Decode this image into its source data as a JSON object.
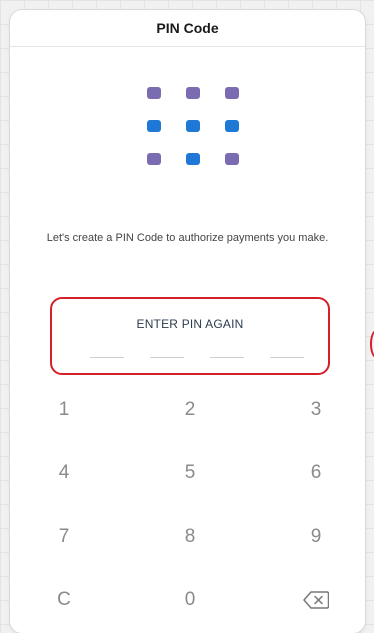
{
  "header": {
    "title": "PIN Code"
  },
  "logo": {
    "dots": [
      "#7b6bb0",
      "#7b6bb0",
      "#7b6bb0",
      "#1f77d6",
      "#1f77d6",
      "#1f77d6",
      "#7b6bb0",
      "#1f77d6",
      "#7b6bb0"
    ]
  },
  "subtitle": "Let's create a PIN Code to authorize payments you make.",
  "pin": {
    "label": "ENTER PIN AGAIN",
    "slots": 4
  },
  "keypad": {
    "keys": [
      "1",
      "2",
      "3",
      "4",
      "5",
      "6",
      "7",
      "8",
      "9",
      "C",
      "0",
      "backspace"
    ]
  },
  "colors": {
    "accent": "#d4202a",
    "primary": "#1f77d6",
    "secondary": "#7b6bb0"
  }
}
